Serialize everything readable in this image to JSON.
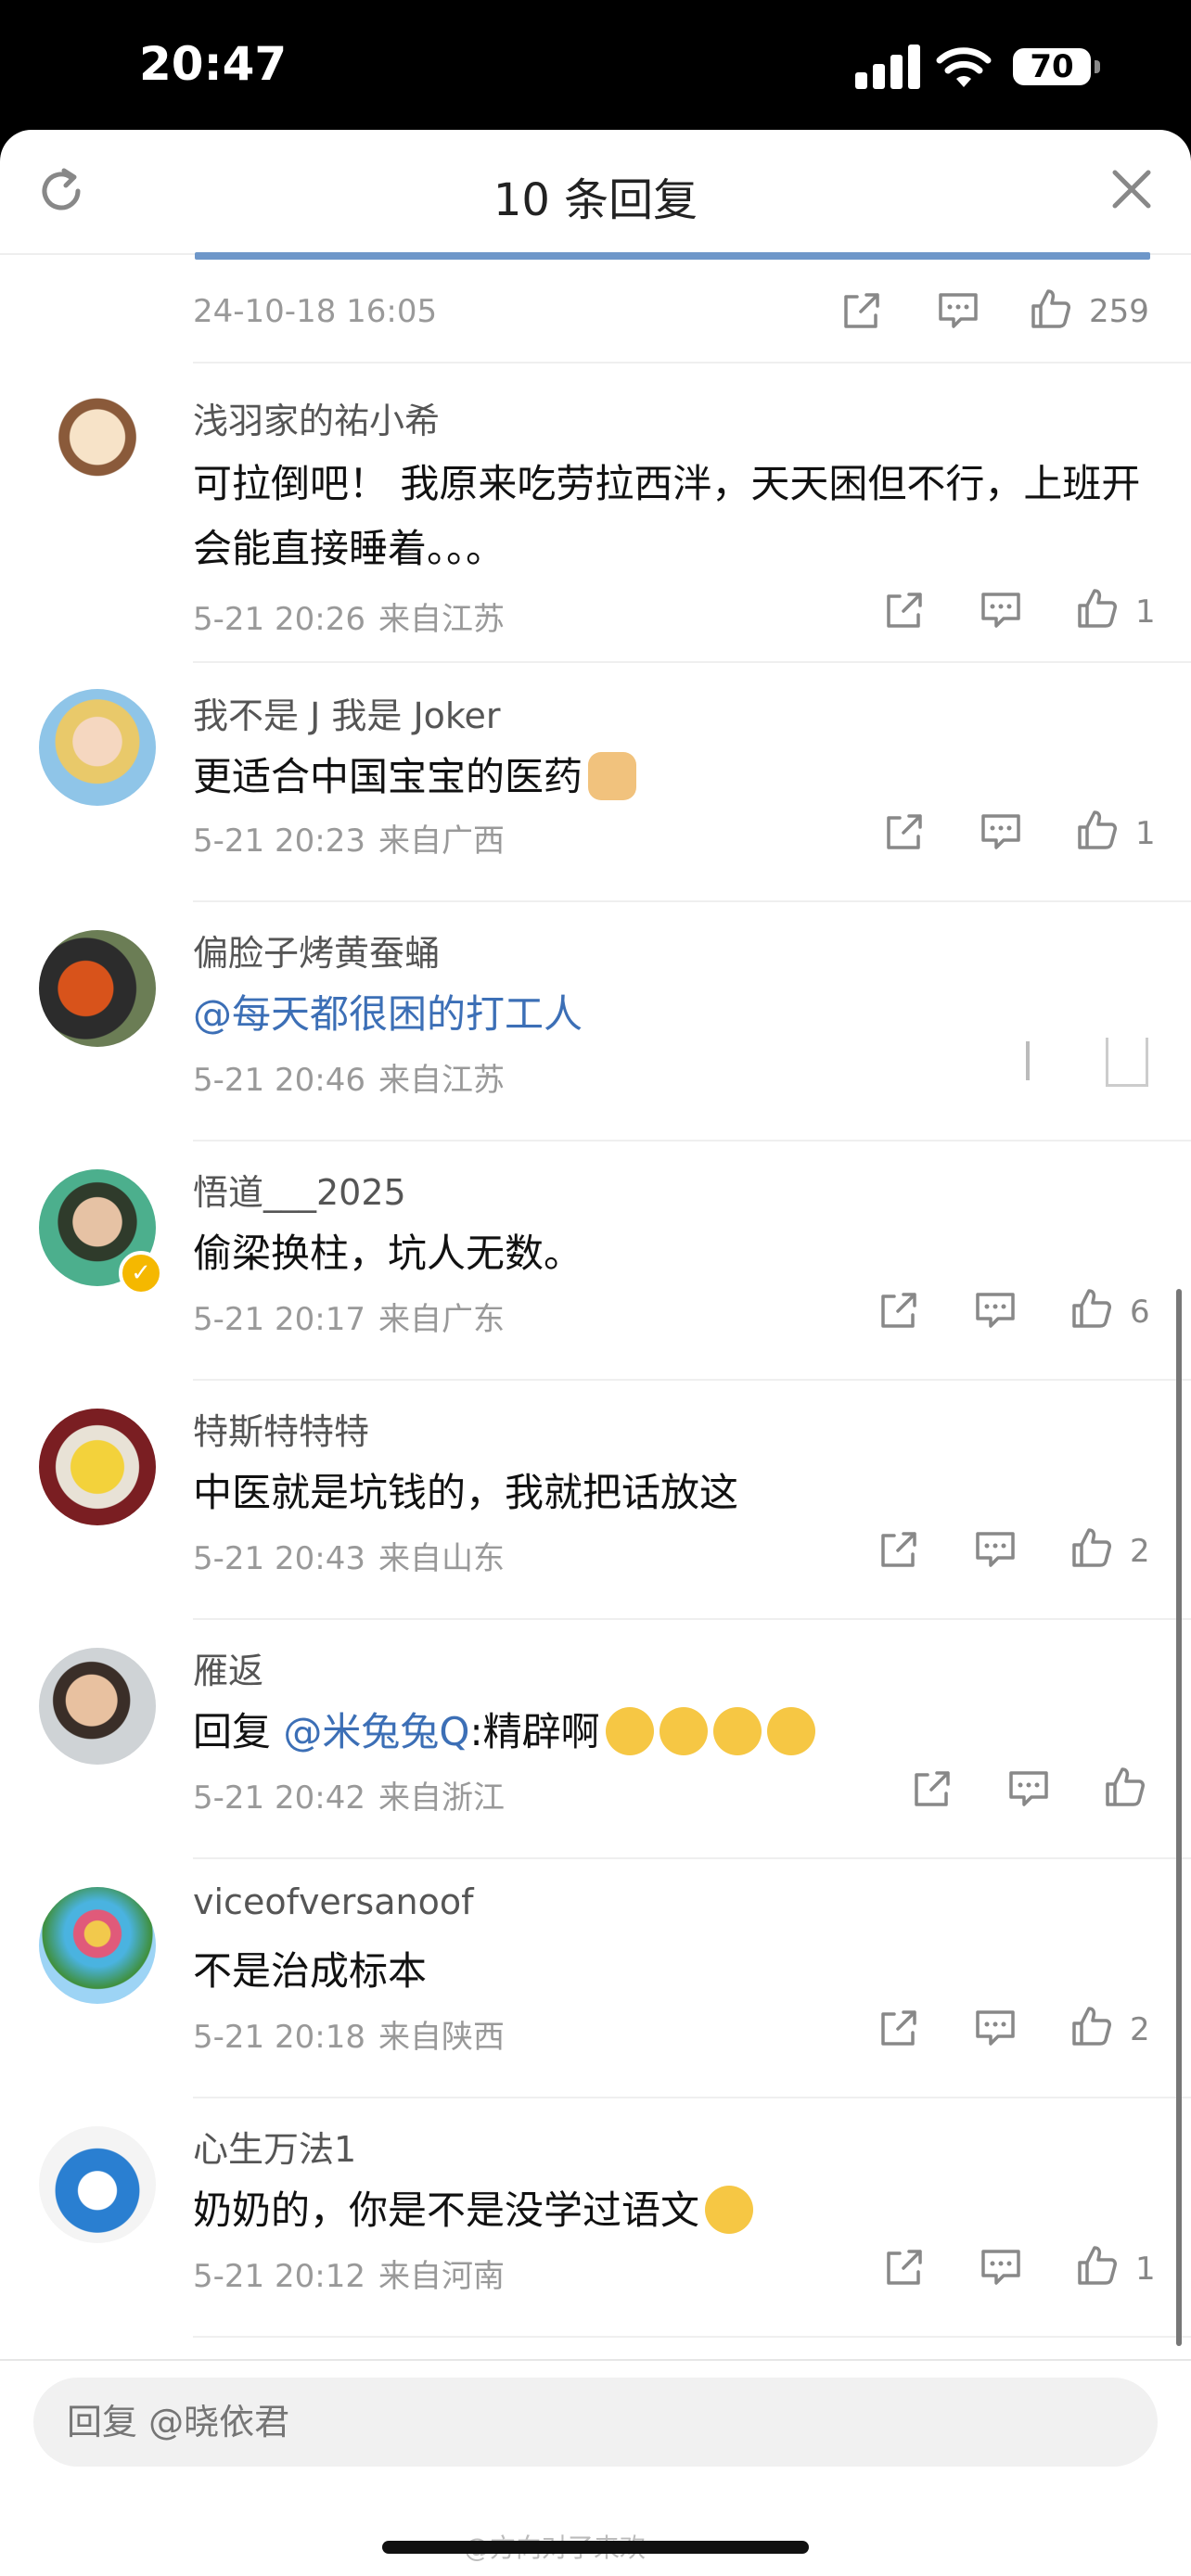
{
  "status_bar": {
    "time": "20:47",
    "battery": "70"
  },
  "header": {
    "title": "10 条回复"
  },
  "previous_comment": {
    "time": "24-10-18 16:05",
    "likes": "259"
  },
  "comments": [
    {
      "name": "浅羽家的祐小希",
      "text": "可拉倒吧！ 我原来吃劳拉西泮，天天困但不行，上班开会能直接睡着。。。",
      "time": "5-21 20:26",
      "location": "来自江苏",
      "likes": "1"
    },
    {
      "name": "我不是 J 我是 Joker",
      "text": "更适合中国宝宝的医药",
      "emoji": "thumbs-up-icon",
      "time": "5-21 20:23",
      "location": "来自广西",
      "likes": "1"
    },
    {
      "name": "偏脸子烤黄蚕蛹",
      "mention": "@每天都很困的打工人",
      "time": "5-21 20:46",
      "location": "来自江苏",
      "likes": ""
    },
    {
      "name": "悟道___2025",
      "text": "偷梁换柱，坑人无数。",
      "time": "5-21 20:17",
      "location": "来自广东",
      "likes": "6",
      "verified": true
    },
    {
      "name": "特斯特特特",
      "text": "中医就是坑钱的，我就把话放这",
      "time": "5-21 20:43",
      "location": "来自山东",
      "likes": "2"
    },
    {
      "name": "雁返",
      "reply_prefix": "回复",
      "mention": "@米兔兔Q",
      "text": ":精辟啊",
      "emoji": "crying-laughing-icon",
      "time": "5-21 20:42",
      "location": "来自浙江",
      "likes": ""
    },
    {
      "name": "viceofversanoof",
      "text": "不是治成标本",
      "time": "5-21 20:18",
      "location": "来自陕西",
      "likes": "2"
    },
    {
      "name": "心生万法1",
      "text": "奶奶的，你是不是没学过语文",
      "emoji": "laughing-tears-icon",
      "time": "5-21 20:12",
      "location": "来自河南",
      "likes": "1"
    }
  ],
  "reply_input": {
    "placeholder": "回复 @晓依君"
  },
  "watermark": "@方向对了来欢",
  "colors": {
    "accent": "#3c6fb6",
    "prev_bar": "#6e97c9"
  }
}
